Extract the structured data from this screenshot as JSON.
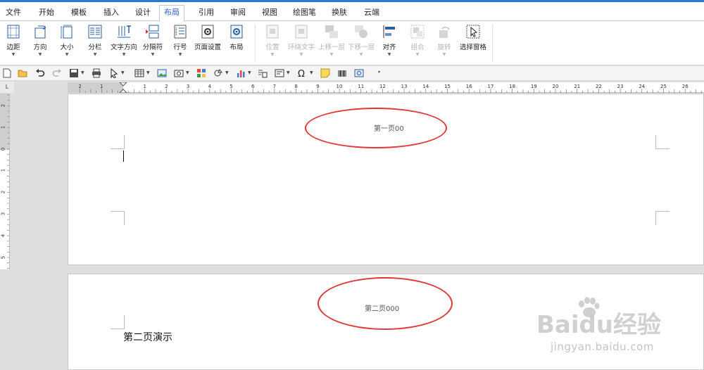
{
  "menu": {
    "items": [
      "文件",
      "开始",
      "模板",
      "插入",
      "设计",
      "布局",
      "引用",
      "审阅",
      "视图",
      "绘图笔",
      "换肤",
      "云端"
    ],
    "active_index": 5
  },
  "ribbon": {
    "buttons": [
      {
        "label": "边距",
        "icon": "margins-icon",
        "dropdown": true,
        "disabled": false
      },
      {
        "label": "方向",
        "icon": "orientation-icon",
        "dropdown": true,
        "disabled": false
      },
      {
        "label": "大小",
        "icon": "page-size-icon",
        "dropdown": true,
        "disabled": false
      },
      {
        "label": "分栏",
        "icon": "columns-icon",
        "dropdown": true,
        "disabled": false
      },
      {
        "label": "文字方向",
        "icon": "text-direction-icon",
        "dropdown": true,
        "disabled": false
      },
      {
        "label": "分隔符",
        "icon": "breaks-icon",
        "dropdown": true,
        "disabled": false
      },
      {
        "label": "行号",
        "icon": "line-numbers-icon",
        "dropdown": true,
        "disabled": false
      },
      {
        "label": "页面设置",
        "icon": "page-setup-icon",
        "dropdown": false,
        "disabled": false
      },
      {
        "label": "布局",
        "icon": "layout-icon",
        "dropdown": false,
        "disabled": false
      },
      {
        "label": "位置",
        "icon": "position-icon",
        "dropdown": true,
        "disabled": true
      },
      {
        "label": "环绕文字",
        "icon": "wrap-text-icon",
        "dropdown": true,
        "disabled": true
      },
      {
        "label": "上移一层",
        "icon": "bring-forward-icon",
        "dropdown": true,
        "disabled": true
      },
      {
        "label": "下移一层",
        "icon": "send-backward-icon",
        "dropdown": true,
        "disabled": true
      },
      {
        "label": "对齐",
        "icon": "align-icon",
        "dropdown": true,
        "disabled": false
      },
      {
        "label": "组合",
        "icon": "group-icon",
        "dropdown": true,
        "disabled": true
      },
      {
        "label": "旋转",
        "icon": "rotate-icon",
        "dropdown": true,
        "disabled": true
      },
      {
        "label": "选择窗格",
        "icon": "selection-pane-icon",
        "dropdown": false,
        "disabled": false
      }
    ]
  },
  "ruler": {
    "h_labels": [
      "2",
      "1",
      "1",
      "2",
      "3",
      "4",
      "5",
      "6",
      "7",
      "8",
      "9",
      "10",
      "11",
      "12",
      "13",
      "14",
      "15",
      "16",
      "17",
      "18",
      "19",
      "20",
      "21",
      "22",
      "23",
      "24",
      "25",
      "26"
    ],
    "v_labels": [
      "2",
      "1",
      "0",
      "1",
      "2",
      "3",
      "4",
      "5"
    ],
    "corner": "L"
  },
  "document": {
    "page1_header": "第一页00",
    "page2_header": "第二页000",
    "page2_body": "第二页演示"
  },
  "watermark": {
    "brand": "Baidu经验",
    "url": "jingyan.baidu.com"
  },
  "colors": {
    "accent": "#2b78d6",
    "annotation": "#e0373a"
  }
}
